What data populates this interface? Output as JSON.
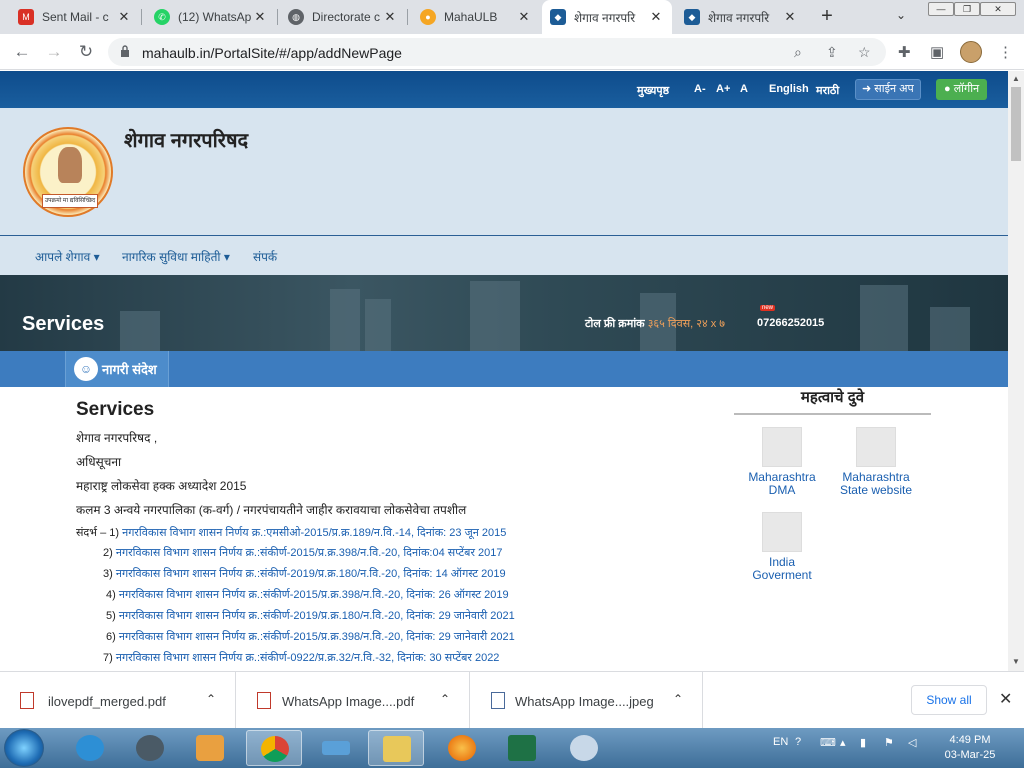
{
  "browser": {
    "tabs": [
      {
        "title": "Sent Mail - c",
        "favicon": "gmail-icon",
        "color": "#d93025",
        "active": false
      },
      {
        "title": "(12) WhatsAp",
        "favicon": "whatsapp-icon",
        "color": "#25d366",
        "active": false
      },
      {
        "title": "Directorate c",
        "favicon": "globe-icon",
        "color": "#5f6368",
        "active": false
      },
      {
        "title": "MahaULB",
        "favicon": "mahaulb-icon",
        "color": "#f5a623",
        "active": false
      },
      {
        "title": "शेगाव नगरपरि",
        "favicon": "emblem-icon",
        "color": "#1d5c96",
        "active": true
      },
      {
        "title": "शेगाव नगरपरि",
        "favicon": "emblem-icon",
        "color": "#1d5c96",
        "active": false
      }
    ],
    "url": "mahaulb.in/PortalSite/#/app/addNewPage"
  },
  "topbar": {
    "home": "मुख्यपृष्ठ",
    "font_small": "A-",
    "font_large": "A+",
    "font_normal": "A",
    "english": "English",
    "marathi": "मराठी",
    "signup": "साईन अप",
    "login": "लॉगीन"
  },
  "header": {
    "site_name": "शेगाव नगरपरिषद",
    "logo_caption": "उपक्रमो मा द्यविसिच्छिद"
  },
  "menu": {
    "item1": "आपले शेगाव",
    "item2": "नागरिक सुविधा माहिती",
    "item3": "संपर्क"
  },
  "banner": {
    "title": "Services",
    "toll_free_label": "टोल फ्री क्रमांक",
    "toll_free_hours": "३६५ दिवस, २४ x ७",
    "new_badge": "new",
    "phone": "07266252015"
  },
  "strip": {
    "label": "नागरी संदेश"
  },
  "content": {
    "heading": "Services",
    "line1": "शेगाव नगरपरिषद ,",
    "line2": "अधिसूचना",
    "line3": "महाराष्ट्र लोकसेवा हक्क अध्यादेश 2015",
    "line4": "कलम 3 अन्वये नगरपालिका (क-वर्ग) / नगरपंचायतीने जाहीर करावयाचा लोकसेवेचा तपशील",
    "references": [
      {
        "num": "संदर्भ – 1)",
        "text": "नगरविकास विभाग शासन निर्णय क्र.:एमसीओ-2015/प्र.क्र.189/न.वि.-14, दिनांक: 23 जून 2015"
      },
      {
        "num": "2)",
        "text": "नगरविकास विभाग शासन निर्णय क्र.:संकीर्ण-2015/प्र.क्र.398/न.वि.-20, दिनांक:04 सप्टेंबर 2017"
      },
      {
        "num": "3)",
        "text": "नगरविकास विभाग शासन निर्णय क्र.:संकीर्ण-2019/प्र.क्र.180/न.वि.-20, दिनांक: 14 ऑगस्ट 2019"
      },
      {
        "num": "4)",
        "text": "नगरविकास विभाग शासन निर्णय क्र.:संकीर्ण-2015/प्र.क्र.398/न.वि.-20, दिनांक: 26 ऑगस्ट 2019"
      },
      {
        "num": "5)",
        "text": "नगरविकास विभाग शासन निर्णय क्र.:संकीर्ण-2019/प्र.क्र.180/न.वि.-20, दिनांक: 29 जानेवारी 2021"
      },
      {
        "num": "6)",
        "text": "नगरविकास विभाग शासन निर्णय क्र.:संकीर्ण-2015/प्र.क्र.398/न.वि.-20, दिनांक: 29 जानेवारी 2021"
      },
      {
        "num": "7)",
        "text": "नगरविकास विभाग शासन निर्णय क्र.:संकीर्ण-0922/प्र.क्र.32/न.वि.-32, दिनांक: 30 सप्टेंबर 2022"
      }
    ]
  },
  "sidebar": {
    "title": "महत्वाचे दुवे",
    "links": [
      {
        "line1": "Maharashtra",
        "line2": "DMA"
      },
      {
        "line1": "Maharashtra",
        "line2": "State website"
      },
      {
        "line1": "India",
        "line2": "Goverment"
      }
    ]
  },
  "downloads": {
    "items": [
      {
        "name": "ilovepdf_merged.pdf",
        "type": "pdf"
      },
      {
        "name": "WhatsApp Image....pdf",
        "type": "pdf"
      },
      {
        "name": "WhatsApp Image....jpeg",
        "type": "image"
      }
    ],
    "show_all": "Show all"
  },
  "taskbar": {
    "lang": "EN",
    "time": "4:49 PM",
    "date": "03-Mar-25"
  }
}
